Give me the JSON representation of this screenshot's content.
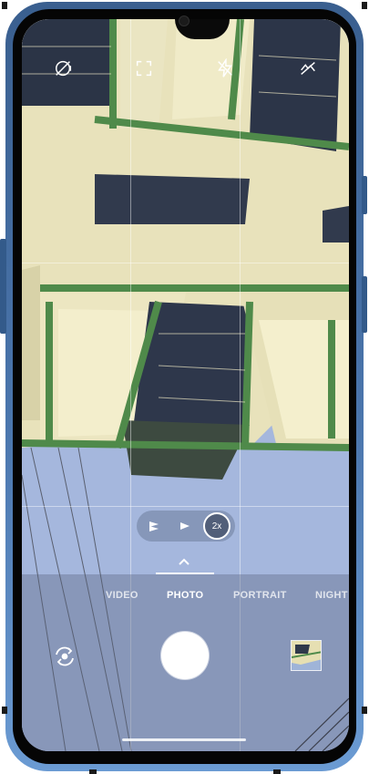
{
  "camera": {
    "top_bar": {
      "icons": [
        "timer-off-icon",
        "aspect-ratio-icon",
        "flash-auto-icon",
        "hdr-off-icon"
      ]
    },
    "zoom": {
      "options": [
        "ultra-wide-icon",
        "wide-icon",
        "2x"
      ],
      "selected_label": "2x"
    },
    "modes": {
      "items": [
        "VIDEO",
        "PHOTO",
        "PORTRAIT",
        "NIGHT"
      ],
      "selected": "PHOTO"
    },
    "controls": {
      "shutter": "shutter-button",
      "switch": "switch-camera-icon",
      "gallery": "gallery-thumbnail"
    },
    "colors": {
      "sky": "#a4b6dc",
      "wall": "#f2ecc8",
      "trim": "#4f8a4a",
      "frame": "#4b76ad"
    }
  }
}
